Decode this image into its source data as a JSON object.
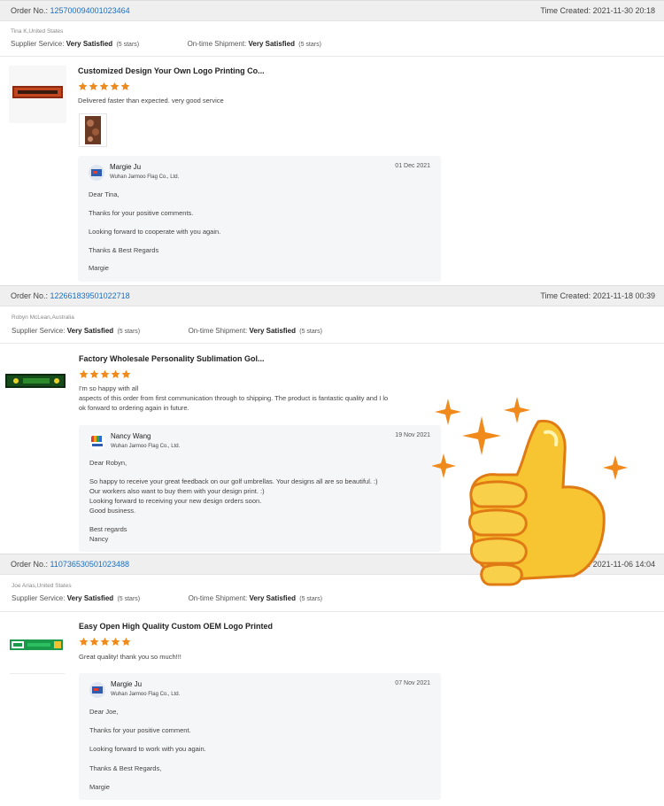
{
  "labels": {
    "order_no": "Order No.:",
    "time_created": "Time Created:",
    "supplier_service": "Supplier Service:",
    "on_time_shipment": "On-time Shipment:"
  },
  "colors": {
    "link": "#1a6fc2",
    "star": "#f08a1c",
    "thumbs_up": "#f7c531"
  },
  "reviews": [
    {
      "order_no": "125700094001023464",
      "time_created": "2021-11-30 20:18",
      "buyer": "Tina K,United States",
      "supplier_rating": "Very Satisfied",
      "supplier_stars": "(5 stars)",
      "shipment_rating": "Very Satisfied",
      "shipment_stars": "(5 stars)",
      "product_title": "Customized Design Your Own Logo Printing Co...",
      "stars": 5,
      "review": "Delivered faster than expected.  very good service",
      "reply": {
        "name": "Margie Ju",
        "company": "Wuhan Jarmoo Flag Co., Ltd.",
        "date": "01 Dec 2021",
        "lines": [
          "Dear Tina,",
          "Thanks for your positive comments.",
          "Looking forward to cooperate with you again.",
          "Thanks & Best Regards",
          "Margie"
        ]
      }
    },
    {
      "order_no": "122661839501022718",
      "time_created": "2021-11-18 00:39",
      "buyer": "Robyn McLean,Australia",
      "supplier_rating": "Very Satisfied",
      "supplier_stars": "(5 stars)",
      "shipment_rating": "Very Satisfied",
      "shipment_stars": "(5 stars)",
      "product_title": "Factory Wholesale Personality Sublimation Gol...",
      "stars": 5,
      "review_lines": [
        "I'm so happy with all",
        "aspects of this order from first communication through to shipping. The product is fantastic quality and I lo",
        "ok forward to ordering again in future."
      ],
      "reply": {
        "name": "Nancy Wang",
        "company": "Wuhan Jarmoo Flag Co., Ltd.",
        "date": "19 Nov 2021",
        "lines": [
          "Dear Robyn,",
          "So happy to receive your great feedback on our golf umbrellas. Your designs all are so beautiful. :)",
          "Our workers also want to buy them with your design print. :)",
          "Looking forward to receiving your new design orders soon.",
          "Good business.",
          "Best regards",
          "Nancy"
        ]
      }
    },
    {
      "order_no": "110736530501023488",
      "time_created": "2021-11-06 14:04",
      "buyer": "Joe Arias,United States",
      "supplier_rating": "Very Satisfied",
      "supplier_stars": "(5 stars)",
      "shipment_rating": "Very Satisfied",
      "shipment_stars": "(5 stars)",
      "product_title": "Easy Open High Quality Custom OEM Logo Printed",
      "stars": 5,
      "review": "Great quality! thank you so much!!!",
      "reply": {
        "name": "Margie Ju",
        "company": "Wuhan Jarmoo Flag Co., Ltd.",
        "date": "07 Nov 2021",
        "lines": [
          "Dear Joe,",
          "Thanks for your positive comment.",
          "Looking forward to work with you again.",
          "Thanks & Best Regards,",
          "Margie"
        ]
      }
    }
  ]
}
